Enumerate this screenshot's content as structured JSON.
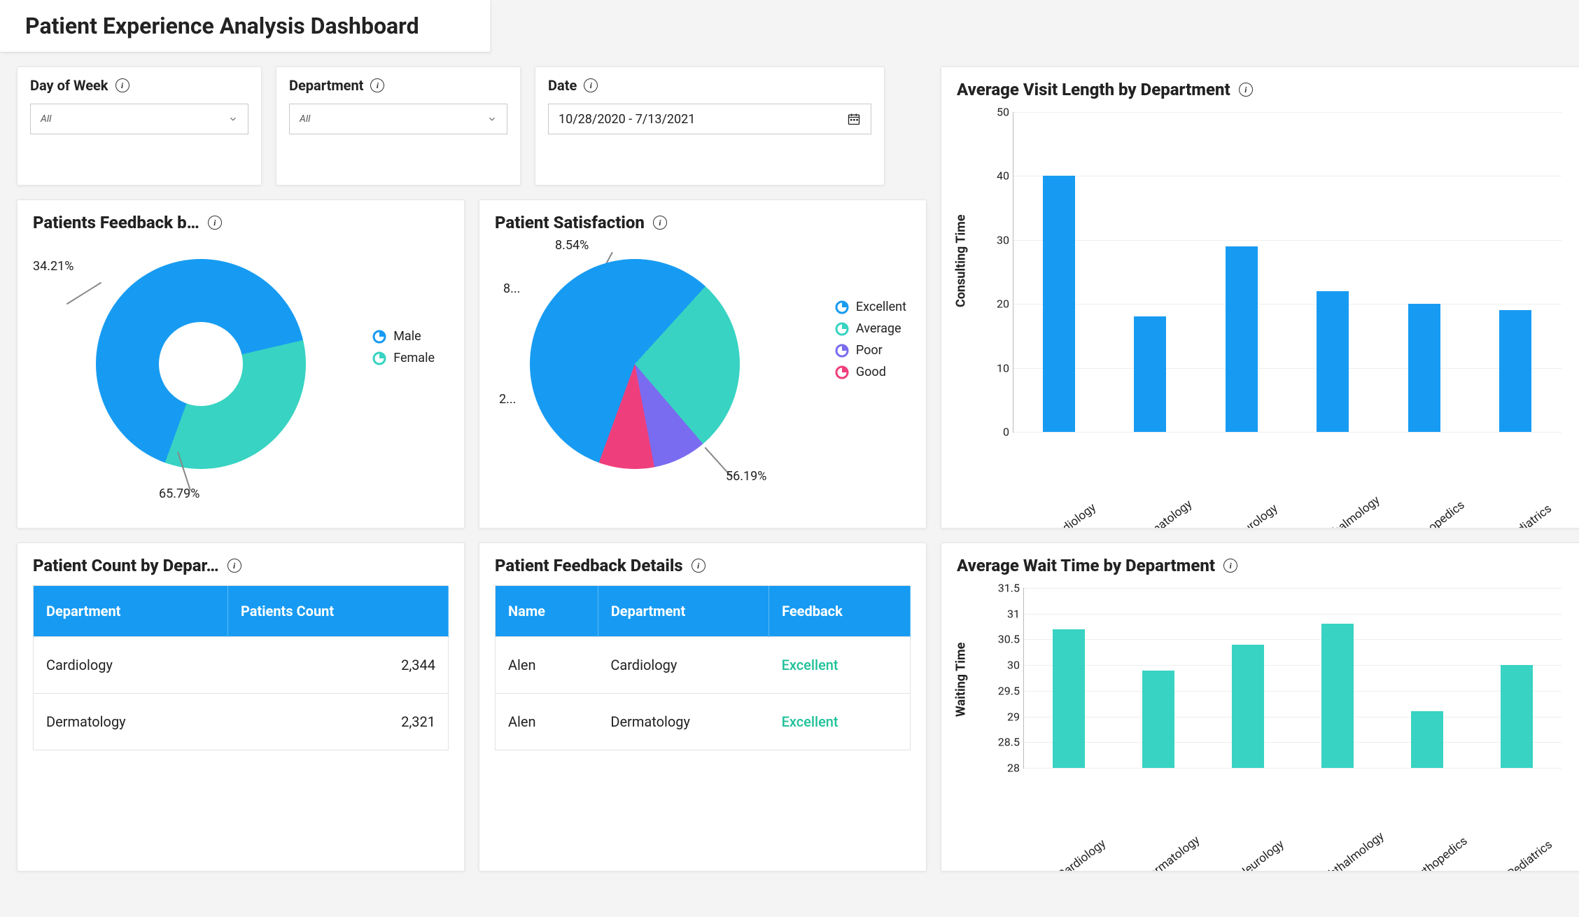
{
  "page_title": "Patient Experience Analysis Dashboard",
  "filters": {
    "day_of_week": {
      "label": "Day of Week",
      "value": "All"
    },
    "department": {
      "label": "Department",
      "value": "All"
    },
    "date": {
      "label": "Date",
      "value": "10/28/2020 - 7/13/2021"
    }
  },
  "cards": {
    "feedback_gender": {
      "title": "Patients Feedback b…",
      "legend": [
        "Male",
        "Female"
      ],
      "labels": {
        "male": "65.79%",
        "female": "34.21%"
      }
    },
    "satisfaction": {
      "title": "Patient Satisfaction",
      "legend": [
        "Excellent",
        "Average",
        "Poor",
        "Good"
      ],
      "labels": {
        "excellent": "56.19%",
        "good": "8.54%",
        "poor": "8...",
        "average": "2..."
      }
    },
    "count_dept": {
      "title": "Patient Count by Depar…",
      "cols": [
        "Department",
        "Patients Count"
      ]
    },
    "feedback_det": {
      "title": "Patient Feedback Details",
      "cols": [
        "Name",
        "Department",
        "Feedback"
      ]
    },
    "visit_len": {
      "title": "Average Visit Length by Department",
      "ylabel": "Consulting Time"
    },
    "wait_time": {
      "title": "Average Wait Time by Department",
      "ylabel": "Waiting Time"
    }
  },
  "tables": {
    "count_dept": [
      {
        "dept": "Cardiology",
        "count": "2,344"
      },
      {
        "dept": "Dermatology",
        "count": "2,321"
      }
    ],
    "feedback_det": [
      {
        "name": "Alen",
        "dept": "Cardiology",
        "fb": "Excellent"
      },
      {
        "name": "Alen",
        "dept": "Dermatology",
        "fb": "Excellent"
      }
    ]
  },
  "chart_data": [
    {
      "id": "feedback_gender",
      "type": "pie",
      "subtype": "donut",
      "title": "Patients Feedback by Gender",
      "series": [
        {
          "name": "Male",
          "value": 65.79,
          "color": "#179bf2"
        },
        {
          "name": "Female",
          "value": 34.21,
          "color": "#38d3c2"
        }
      ],
      "unit": "%"
    },
    {
      "id": "satisfaction",
      "type": "pie",
      "title": "Patient Satisfaction",
      "series": [
        {
          "name": "Excellent",
          "value": 56.19,
          "color": "#179bf2"
        },
        {
          "name": "Average",
          "value": 27.0,
          "color": "#38d3c2"
        },
        {
          "name": "Poor",
          "value": 8.27,
          "color": "#7a6cf0"
        },
        {
          "name": "Good",
          "value": 8.54,
          "color": "#ef3e7c"
        }
      ],
      "unit": "%"
    },
    {
      "id": "visit_len",
      "type": "bar",
      "title": "Average Visit Length by Department",
      "ylabel": "Consulting Time",
      "ylim": [
        0,
        50
      ],
      "yticks": [
        0,
        10,
        20,
        30,
        40,
        50
      ],
      "categories": [
        "Cardiology",
        "Dermatology",
        "Neurology",
        "Ophthalmology",
        "Orthopedics",
        "Pediatrics"
      ],
      "values": [
        40,
        18,
        29,
        22,
        20,
        19
      ],
      "color": "#179bf2"
    },
    {
      "id": "wait_time",
      "type": "bar",
      "title": "Average Wait Time by Department",
      "ylabel": "Waiting Time",
      "ylim": [
        28,
        31.5
      ],
      "yticks": [
        28,
        28.5,
        29,
        29.5,
        30,
        30.5,
        31,
        31.5
      ],
      "categories": [
        "Cardiology",
        "Dermatology",
        "Neurology",
        "Ophthalmology",
        "Orthopedics",
        "Pediatrics"
      ],
      "values": [
        30.7,
        29.9,
        30.4,
        30.8,
        29.1,
        30.0
      ],
      "color": "#38d3c2"
    }
  ]
}
